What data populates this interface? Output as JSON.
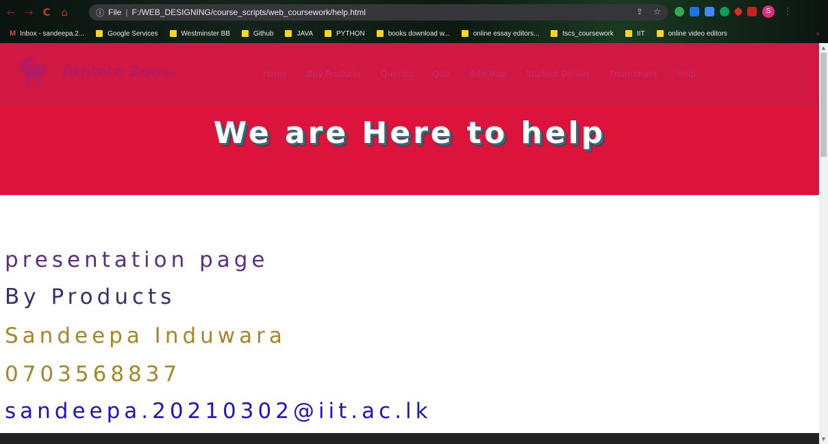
{
  "browser": {
    "nav": {
      "back": "←",
      "forward": "→",
      "reload": "C",
      "home": "⌂"
    },
    "omnibox": {
      "info_icon": "ⓘ",
      "scheme_label": "File",
      "separator": "|",
      "url": "F:/WEB_DESIGNING/course_scripts/web_coursework/help.html"
    },
    "omni_icons": {
      "share": "⇪",
      "star": "☆"
    },
    "profile_initial": "S",
    "menu": "⋮",
    "bookmarks": [
      {
        "label": "Inbox - sandeepa.2...",
        "icon": "gmail-icon"
      },
      {
        "label": "Google Services",
        "icon": "folder-icon"
      },
      {
        "label": "Westminster BB",
        "icon": "folder-icon"
      },
      {
        "label": "Github",
        "icon": "folder-icon"
      },
      {
        "label": "JAVA",
        "icon": "folder-icon"
      },
      {
        "label": "PYTHON",
        "icon": "folder-icon"
      },
      {
        "label": "books download w...",
        "icon": "folder-icon"
      },
      {
        "label": "online essay editors...",
        "icon": "folder-icon"
      },
      {
        "label": "tscs_coursework",
        "icon": "folder-icon"
      },
      {
        "label": "IIT",
        "icon": "folder-icon"
      },
      {
        "label": "online video editors",
        "icon": "folder-icon"
      }
    ],
    "bookmarks_more": "»",
    "extension_colors": [
      "#34a853",
      "#1a73e8",
      "#4285f4",
      "#0f9d58",
      "#d93025",
      "#c5221f"
    ]
  },
  "site": {
    "brand": "Athlete Zone.",
    "nav": [
      "Home",
      "Buy Products",
      "Queries",
      "Quiz",
      "Site Map",
      "Student Details",
      "Thumbnails",
      "Help"
    ],
    "hero_title": "We are Here to help",
    "colors": {
      "header": "#d01843",
      "hero": "#dc143c"
    }
  },
  "content": {
    "line1": "presentation page",
    "line2": "By Products",
    "line3": "Sandeepa Induwara",
    "line4": "0703568837",
    "line5": "sandeepa.20210302@iit.ac.lk"
  }
}
